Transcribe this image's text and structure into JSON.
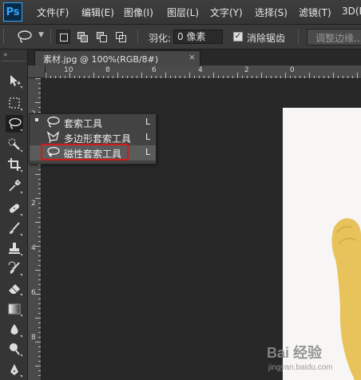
{
  "app": {
    "logo": "Ps"
  },
  "menubar": {
    "items": [
      "文件(F)",
      "编辑(E)",
      "图像(I)",
      "图层(L)",
      "文字(Y)",
      "选择(S)",
      "滤镜(T)",
      "3D(D"
    ]
  },
  "options": {
    "feather_label": "羽化:",
    "feather_value": "0 像素",
    "antialias_label": "消除锯齿",
    "antialias_checked": true,
    "refine_edge": "调整边缘..."
  },
  "document": {
    "tab_title": "素材.jpg @ 100%(RGB/8#)",
    "close": "×"
  },
  "ruler": {
    "top": [
      "10",
      "8",
      "6",
      "4",
      "2",
      "0"
    ],
    "left": [
      "2",
      "0",
      "2",
      "4",
      "6",
      "8"
    ]
  },
  "tools": [
    {
      "name": "move-tool",
      "icon": "move-icon"
    },
    {
      "name": "marquee-tool",
      "icon": "rect-marquee-icon"
    },
    {
      "name": "lasso-tool",
      "icon": "lasso-icon",
      "selected": true
    },
    {
      "name": "quick-select-tool",
      "icon": "quick-select-icon"
    },
    {
      "name": "crop-tool",
      "icon": "crop-icon"
    },
    {
      "name": "eyedropper-tool",
      "icon": "eyedropper-icon"
    },
    {
      "name": "healing-tool",
      "icon": "bandage-icon"
    },
    {
      "name": "brush-tool",
      "icon": "brush-icon"
    },
    {
      "name": "stamp-tool",
      "icon": "stamp-icon"
    },
    {
      "name": "history-brush-tool",
      "icon": "history-brush-icon"
    },
    {
      "name": "eraser-tool",
      "icon": "eraser-icon"
    },
    {
      "name": "gradient-tool",
      "icon": "gradient-icon"
    },
    {
      "name": "blur-tool",
      "icon": "blur-icon"
    },
    {
      "name": "dodge-tool",
      "icon": "dodge-icon"
    },
    {
      "name": "pen-tool",
      "icon": "pen-icon"
    }
  ],
  "flyout": {
    "items": [
      {
        "label": "套索工具",
        "shortcut": "L",
        "active": true,
        "icon": "lasso-icon"
      },
      {
        "label": "多边形套索工具",
        "shortcut": "L",
        "active": false,
        "icon": "polygon-lasso-icon"
      },
      {
        "label": "磁性套索工具",
        "shortcut": "L",
        "active": false,
        "icon": "magnetic-lasso-icon",
        "highlighted": true
      }
    ]
  },
  "watermark": {
    "text": "Bai 经验",
    "sub": "jingyan.baidu.com"
  },
  "colors": {
    "highlight_box": "#d21a1a",
    "accent": "#31a8ff",
    "shape_fill": "#e8c25a"
  }
}
